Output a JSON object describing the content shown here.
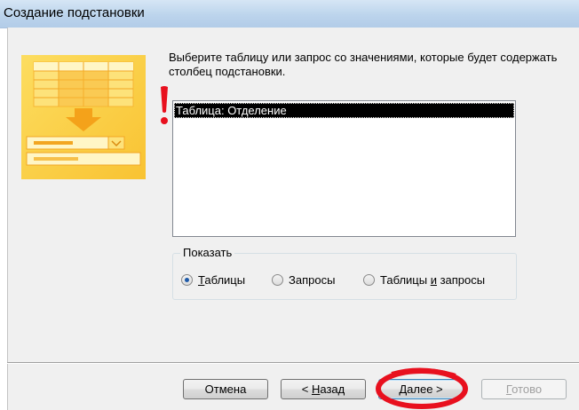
{
  "window": {
    "title": "Создание подстановки"
  },
  "wizard": {
    "instruction": "Выберите таблицу или запрос со значениями, которые будет содержать столбец подстановки.",
    "list_items": [
      {
        "label": "Таблица: Отделение",
        "selected": true
      }
    ]
  },
  "show_group": {
    "legend": "Показать",
    "options": [
      {
        "pre": "",
        "mnemonic": "Т",
        "post": "аблицы",
        "checked": true
      },
      {
        "pre": "",
        "mnemonic": "",
        "post": "Запросы",
        "checked": false
      },
      {
        "pre": "Таблицы ",
        "mnemonic": "и",
        "post": " запросы",
        "checked": false
      }
    ]
  },
  "buttons": {
    "cancel": {
      "label": "Отмена"
    },
    "back": {
      "pre": "< ",
      "mnemonic": "Н",
      "post": "азад"
    },
    "next": {
      "pre": "",
      "mnemonic": "Д",
      "post": "алее >"
    },
    "finish": {
      "pre": "",
      "mnemonic": "Г",
      "post": "отово",
      "disabled": true
    }
  },
  "colors": {
    "selection": "#000000",
    "annotation": "#e8101e",
    "illustration_bg": "#fbd13d"
  }
}
